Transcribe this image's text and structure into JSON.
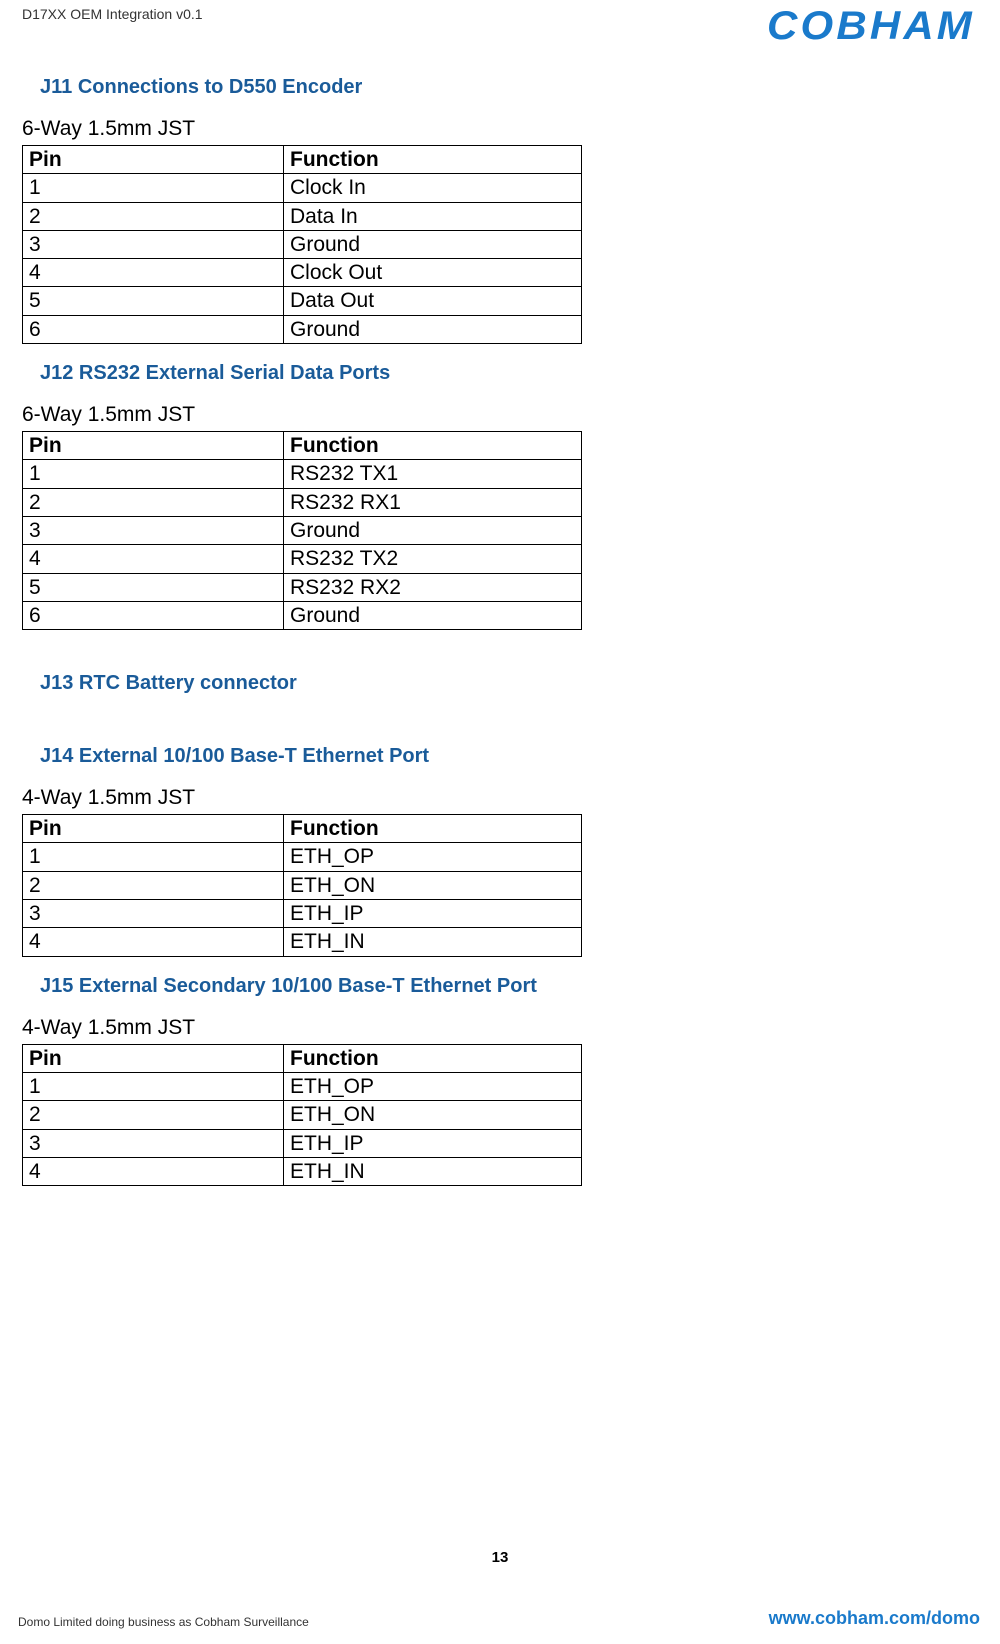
{
  "header": {
    "doc_title": "D17XX OEM Integration v0.1",
    "logo_text": "COBHAM"
  },
  "sections": {
    "j11": {
      "heading": "J11 Connections to D550 Encoder",
      "subtitle": "6-Way 1.5mm JST",
      "col_pin": "Pin",
      "col_function": "Function",
      "rows": [
        {
          "pin": "1",
          "func": "Clock In"
        },
        {
          "pin": "2",
          "func": "Data In"
        },
        {
          "pin": "3",
          "func": "Ground"
        },
        {
          "pin": "4",
          "func": "Clock Out"
        },
        {
          "pin": "5",
          "func": "Data Out"
        },
        {
          "pin": "6",
          "func": "Ground"
        }
      ]
    },
    "j12": {
      "heading": "J12 RS232 External Serial Data Ports",
      "subtitle": "6-Way 1.5mm JST",
      "col_pin": "Pin",
      "col_function": "Function",
      "rows": [
        {
          "pin": "1",
          "func": "RS232 TX1"
        },
        {
          "pin": "2",
          "func": "RS232 RX1"
        },
        {
          "pin": "3",
          "func": "Ground"
        },
        {
          "pin": "4",
          "func": "RS232 TX2"
        },
        {
          "pin": "5",
          "func": "RS232 RX2"
        },
        {
          "pin": "6",
          "func": "Ground"
        }
      ]
    },
    "j13": {
      "heading": "J13 RTC Battery connector"
    },
    "j14": {
      "heading": "J14 External 10/100 Base-T Ethernet Port",
      "subtitle": "4-Way 1.5mm JST",
      "col_pin": "Pin",
      "col_function": "Function",
      "rows": [
        {
          "pin": "1",
          "func": "ETH_OP"
        },
        {
          "pin": "2",
          "func": "ETH_ON"
        },
        {
          "pin": "3",
          "func": "ETH_IP"
        },
        {
          "pin": "4",
          "func": "ETH_IN"
        }
      ]
    },
    "j15": {
      "heading": "J15 External Secondary 10/100 Base-T Ethernet Port",
      "subtitle": "4-Way 1.5mm JST",
      "col_pin": "Pin",
      "col_function": "Function",
      "rows": [
        {
          "pin": "1",
          "func": "ETH_OP"
        },
        {
          "pin": "2",
          "func": "ETH_ON"
        },
        {
          "pin": "3",
          "func": "ETH_IP"
        },
        {
          "pin": "4",
          "func": "ETH_IN"
        }
      ]
    }
  },
  "footer": {
    "page_number": "13",
    "left_text": "Domo Limited doing business as Cobham Surveillance",
    "right_text": "www.cobham.com/domo"
  }
}
